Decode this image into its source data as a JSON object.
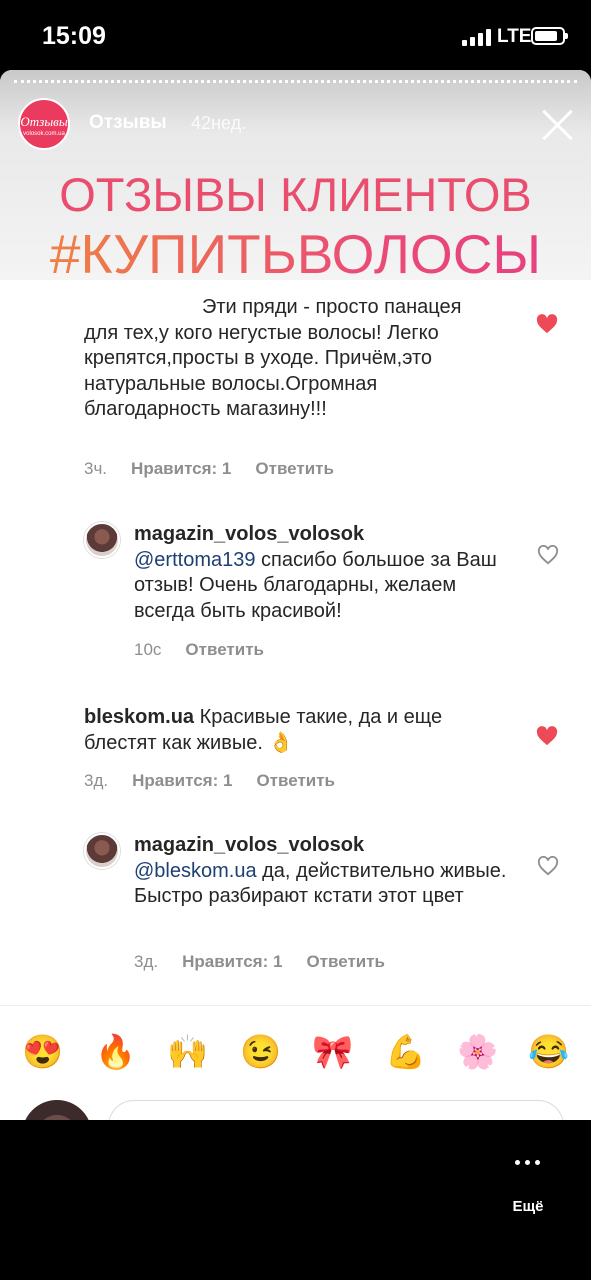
{
  "status_bar": {
    "time": "15:09",
    "network": "LTE"
  },
  "story": {
    "account": "Отзывы",
    "time_ago": "42нед.",
    "logo": {
      "main": "Отзывы",
      "sub": "volosok.com.ua"
    },
    "headline_1": "ОТЗЫВЫ КЛИЕНТОВ",
    "headline_2": "#КУПИТЬВОЛОСЫ"
  },
  "comments": [
    {
      "text": "Эти пряди - просто панацея для тех,у кого негустые волосы! Легко крепятся,просты в уходе. Причём,это натуральные волосы.Огромная благодарность магазину!!!",
      "time": "3ч.",
      "likes": "Нравится: 1",
      "reply": "Ответить",
      "liked": true
    },
    {
      "user": "magazin_volos_volosok",
      "mention": "@erttoma139",
      "text": "спасибо большое за Ваш отзыв! Очень благодарны, желаем всегда быть красивой!",
      "time": "10с",
      "reply": "Ответить",
      "liked": false
    },
    {
      "user": "bleskom.ua",
      "text": "Красивые такие, да и еще блестят как живые. 👌",
      "time": "3д.",
      "likes": "Нравится: 1",
      "reply": "Ответить",
      "liked": true
    },
    {
      "user": "magazin_volos_volosok",
      "mention": "@bleskom.ua",
      "text": "да, действительно живые. Быстро разбирают кстати этот цвет",
      "time": "3д.",
      "likes": "Нравится: 1",
      "reply": "Ответить",
      "liked": false
    }
  ],
  "emoji_bar": [
    "😍",
    "🔥",
    "🙌",
    "😉",
    "🎀",
    "💪",
    "🌸",
    "😂"
  ],
  "controls": {
    "more_label": "Ещё"
  },
  "colors": {
    "heart_red": "#ed4956",
    "headline_pink": "#ea4e6f",
    "mention": "#1d3f74"
  }
}
